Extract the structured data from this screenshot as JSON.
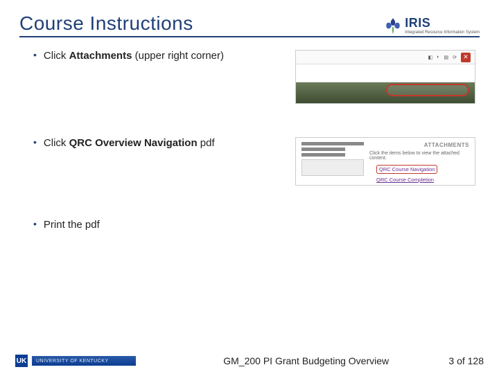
{
  "header": {
    "title": "Course Instructions",
    "logo": {
      "brand": "IRIS",
      "tagline": "Integrated Resource Information System"
    }
  },
  "bullets": [
    {
      "prefix": "Click ",
      "bold": "Attachments",
      "suffix": " (upper right corner)"
    },
    {
      "prefix": "Click ",
      "bold": "QRC Overview Navigation",
      "suffix": " pdf"
    },
    {
      "prefix": "Print the pdf",
      "bold": "",
      "suffix": ""
    }
  ],
  "thumb2": {
    "panel_title": "ATTACHMENTS",
    "instruction": "Click the items below to view the attached content.",
    "link1": "QRC Course Navigation",
    "link2": "QRC Course Completion"
  },
  "footer": {
    "uk_initials": "UK",
    "uk_label": "UNIVERSITY OF KENTUCKY",
    "course": "GM_200 PI Grant Budgeting Overview",
    "page": "3 of 128"
  }
}
